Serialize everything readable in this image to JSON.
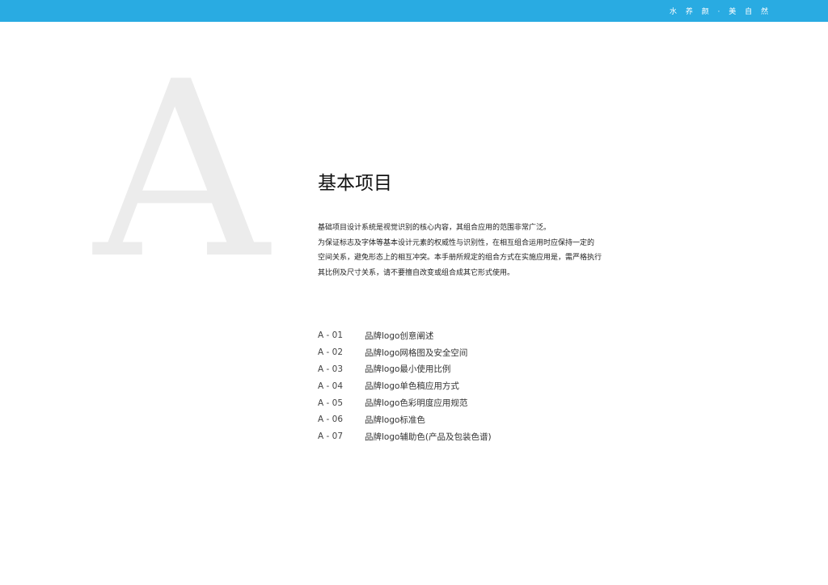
{
  "header": {
    "slogan": "水 养 颜 · 美 自 然",
    "bar_color": "#29abe2"
  },
  "section": {
    "letter": "A",
    "title": "基本项目",
    "intro_lines": [
      "基础项目设计系统是视觉识别的核心内容，其组合应用的范围非常广泛。",
      "为保证标志及字体等基本设计元素的权威性与识别性，在相互组合运用时应保持一定的",
      "空间关系，避免形态上的相互冲突。本手册所规定的组合方式在实施应用是，需严格执行",
      "其比例及尺寸关系，请不要擅自改变或组合成其它形式使用。"
    ]
  },
  "toc": {
    "items": [
      {
        "code": "A - 01",
        "label": "品牌logo创意阐述"
      },
      {
        "code": "A - 02",
        "label": "品牌logo网格图及安全空间"
      },
      {
        "code": "A - 03",
        "label": "品牌logo最小使用比例"
      },
      {
        "code": "A - 04",
        "label": "品牌logo单色稿应用方式"
      },
      {
        "code": "A - 05",
        "label": "品牌logo色彩明度应用规范"
      },
      {
        "code": "A - 06",
        "label": "品牌logo标准色"
      },
      {
        "code": "A - 07",
        "label": "品牌logo辅助色(产品及包装色谱)"
      }
    ]
  }
}
